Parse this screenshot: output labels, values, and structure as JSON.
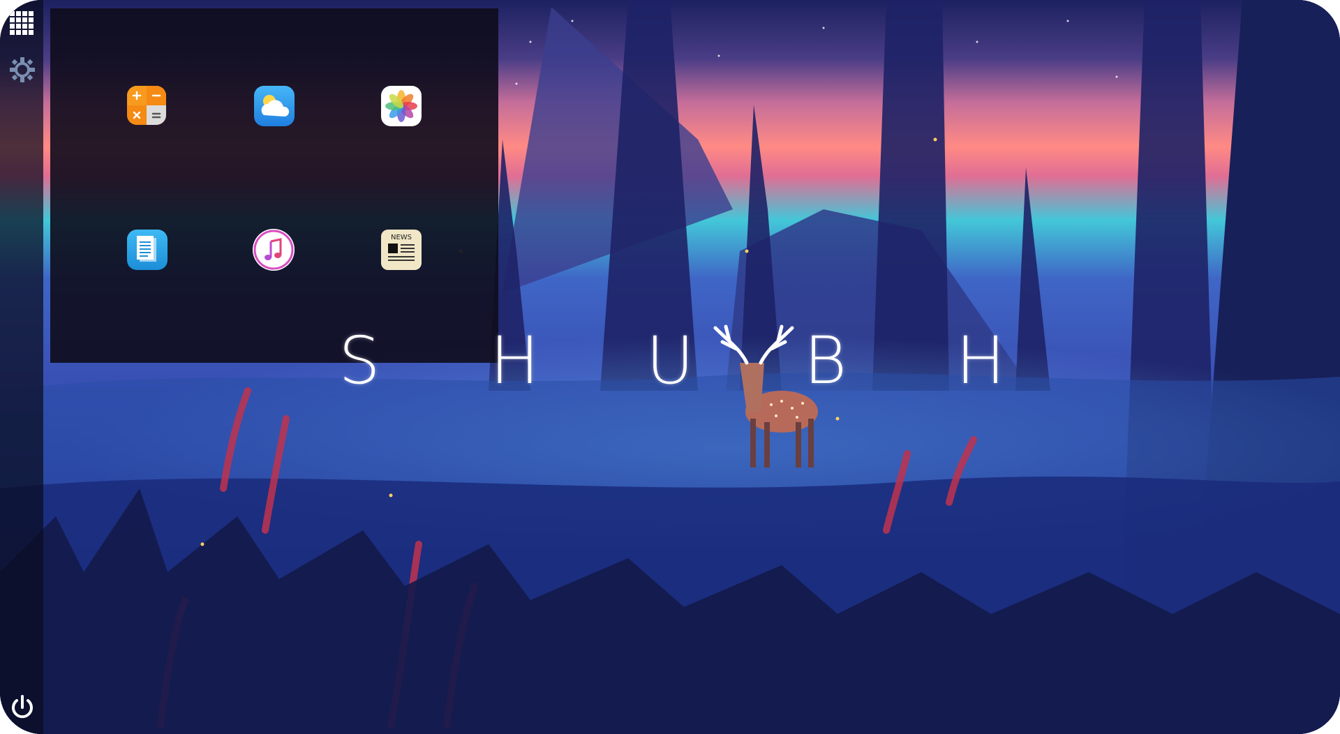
{
  "desktop": {
    "title_letters": [
      "S",
      "H",
      "U",
      "B",
      "H"
    ]
  },
  "sidebar": {
    "items": [
      {
        "name": "app-grid",
        "icon": "grid-icon"
      },
      {
        "name": "settings",
        "icon": "gear-icon"
      },
      {
        "name": "power",
        "icon": "power-icon"
      }
    ]
  },
  "launcher": {
    "apps": [
      {
        "icon": "calculator-icon",
        "color": "#f79a1e"
      },
      {
        "icon": "weather-icon",
        "color": "#2e9df0"
      },
      {
        "icon": "photos-icon",
        "color": "#ffffff"
      },
      {
        "icon": "documents-icon",
        "color": "#2aa6ea"
      },
      {
        "icon": "music-icon",
        "color": "#ffffff"
      },
      {
        "icon": "news-icon",
        "color": "#f1e6c6",
        "label": "NEWS"
      }
    ]
  }
}
